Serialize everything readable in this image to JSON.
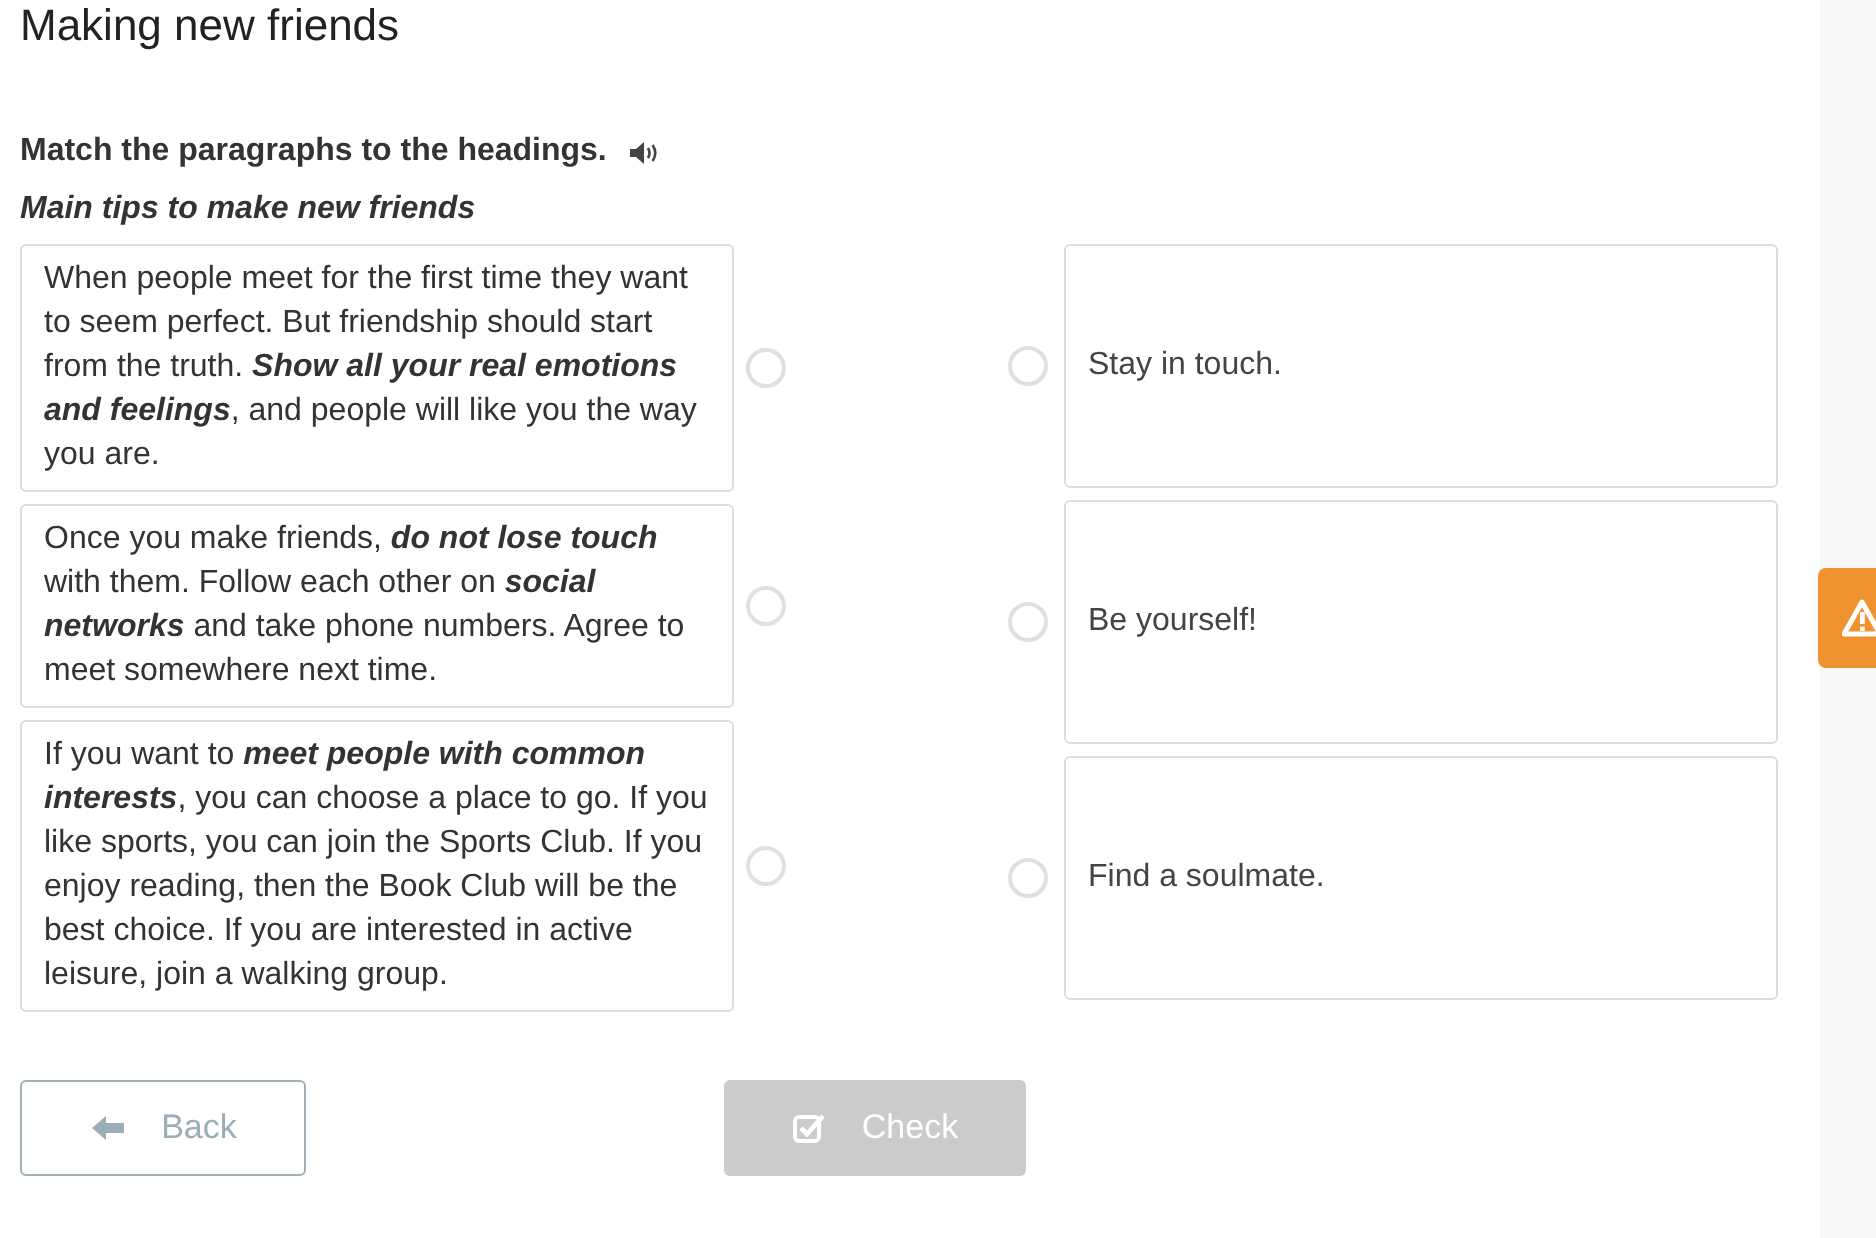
{
  "title": "Making new friends",
  "instruction": "Match the paragraphs to the headings.",
  "subtitle": "Main tips to make new friends",
  "paragraphs": [
    {
      "text": "When people meet for the first time they want to seem perfect. But friendship should start from the truth. **Show all your real emotions and feelings**, and people will like you the way you are.",
      "selected": false
    },
    {
      "text": "Once you make friends, **do not lose touch** with them. Follow each other on **social networks** and take phone numbers. Agree to meet somewhere next time.",
      "selected": false
    },
    {
      "text": "If you want to **meet people with common interests**, you can choose a place to go. If you like sports, you can join the Sports Club. If you enjoy reading, then the Book Club will be the best choice. If you are interested in active leisure, join a walking group.",
      "selected": false
    }
  ],
  "headings": [
    {
      "text": "Stay in touch.",
      "selected": false
    },
    {
      "text": "Be yourself!",
      "selected": false
    },
    {
      "text": "Find a soulmate.",
      "selected": false
    }
  ],
  "buttons": [
    {
      "kind": "back",
      "label": "Back",
      "disabled": false
    },
    {
      "kind": "check",
      "label": "Check",
      "disabled": true
    }
  ]
}
